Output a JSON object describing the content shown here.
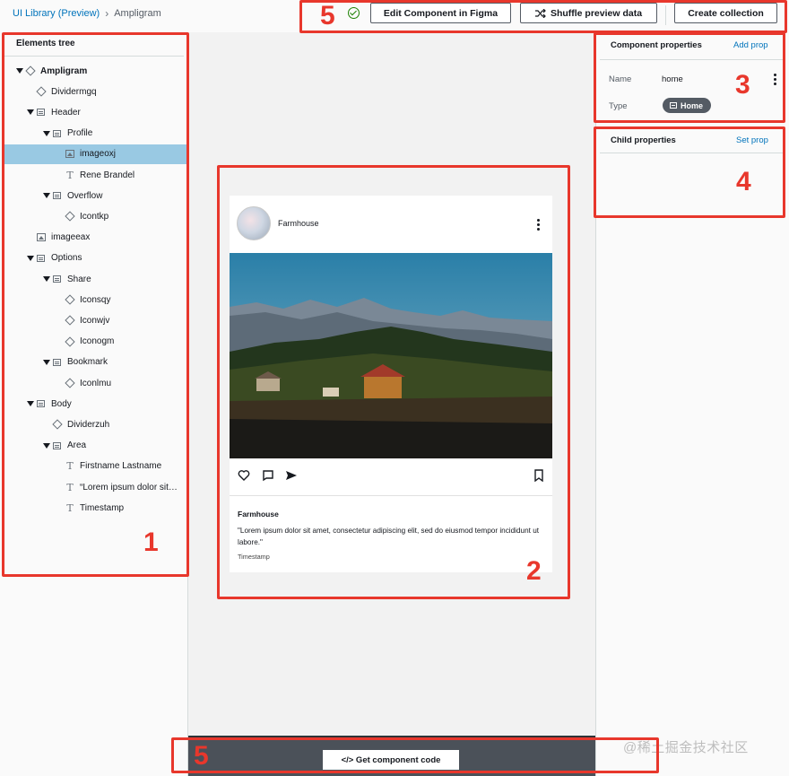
{
  "breadcrumb": {
    "root": "UI Library (Preview)",
    "separator": "›",
    "current": "Ampligram"
  },
  "toolbar": {
    "edit_figma_label": "Edit Component in Figma",
    "shuffle_label": "Shuffle preview data",
    "create_collection_label": "Create collection",
    "status_icon": "check-circle-icon"
  },
  "tree": {
    "title": "Elements tree",
    "items": [
      {
        "label": "Ampligram",
        "icon": "cube",
        "expanded": true,
        "level": 0
      },
      {
        "label": "Dividermgq",
        "icon": "cube",
        "expanded": false,
        "level": 1
      },
      {
        "label": "Header",
        "icon": "frame",
        "expanded": true,
        "level": 1
      },
      {
        "label": "Profile",
        "icon": "frame",
        "expanded": true,
        "level": 2
      },
      {
        "label": "imageoxj",
        "icon": "image",
        "expanded": false,
        "level": 3
      },
      {
        "label": "Rene Brandel",
        "icon": "text",
        "expanded": false,
        "level": 3
      },
      {
        "label": "Overflow",
        "icon": "frame",
        "expanded": true,
        "level": 2
      },
      {
        "label": "Icontkp",
        "icon": "cube",
        "expanded": false,
        "level": 3
      },
      {
        "label": "imageeax",
        "icon": "image",
        "expanded": false,
        "level": 1
      },
      {
        "label": "Options",
        "icon": "frame",
        "expanded": true,
        "level": 1
      },
      {
        "label": "Share",
        "icon": "frame",
        "expanded": true,
        "level": 2
      },
      {
        "label": "Iconsqy",
        "icon": "cube",
        "expanded": false,
        "level": 3
      },
      {
        "label": "Iconwjv",
        "icon": "cube",
        "expanded": false,
        "level": 3
      },
      {
        "label": "Iconogm",
        "icon": "cube",
        "expanded": false,
        "level": 3
      },
      {
        "label": "Bookmark",
        "icon": "frame",
        "expanded": true,
        "level": 2
      },
      {
        "label": "Iconlmu",
        "icon": "cube",
        "expanded": false,
        "level": 3
      },
      {
        "label": "Body",
        "icon": "frame",
        "expanded": true,
        "level": 1
      },
      {
        "label": "Dividerzuh",
        "icon": "cube",
        "expanded": false,
        "level": 2
      },
      {
        "label": "Area",
        "icon": "frame",
        "expanded": true,
        "level": 2
      },
      {
        "label": "Firstname Lastname",
        "icon": "text",
        "expanded": false,
        "level": 3
      },
      {
        "label": "“Lorem ipsum dolor sit…",
        "icon": "text",
        "expanded": false,
        "level": 3
      },
      {
        "label": "Timestamp",
        "icon": "text",
        "expanded": false,
        "level": 3
      }
    ],
    "selected_index": 4
  },
  "preview": {
    "header_name": "Farmhouse",
    "author": "Farmhouse",
    "body": "\"Lorem ipsum dolor sit amet, consectetur adipiscing elit, sed do eiusmod tempor incididunt ut labore.\"",
    "timestamp": "Timestamp"
  },
  "component_properties": {
    "title": "Component properties",
    "add_label": "Add prop",
    "name_label": "Name",
    "name_value": "home",
    "type_label": "Type",
    "type_value": "Home"
  },
  "child_properties": {
    "title": "Child properties",
    "set_label": "Set prop"
  },
  "bottom": {
    "code_button_label": "</> Get component code"
  },
  "watermark": "@稀土掘金技术社区",
  "annotations": {
    "n1": "1",
    "n2": "2",
    "n3": "3",
    "n4": "4",
    "n5_top": "5",
    "n5_bottom": "5"
  },
  "colors": {
    "accent_link": "#0073bb",
    "selected_row": "#99c9e3",
    "annotation": "#e8372c",
    "success": "#1d8102"
  }
}
